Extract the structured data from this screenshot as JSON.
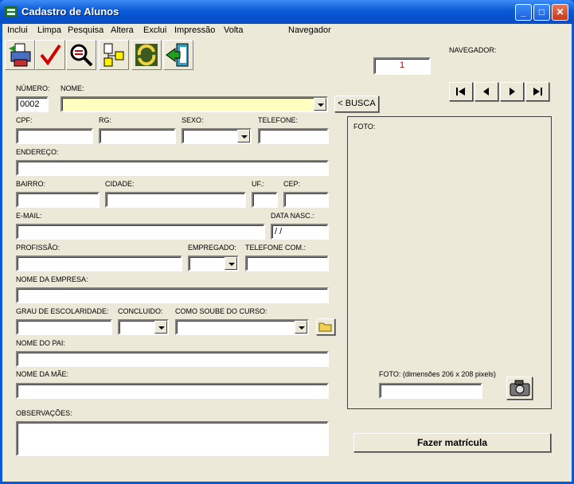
{
  "window": {
    "title": "Cadastro de Alunos",
    "minimize_glyph": "_",
    "maximize_glyph": "□",
    "close_glyph": "✕"
  },
  "menu": [
    "Inclui",
    "Limpa",
    "Pesquisa",
    "Altera",
    "Exclui",
    "Impressão",
    "Volta",
    "Navegador"
  ],
  "toolbar": [
    {
      "name": "include-icon"
    },
    {
      "name": "check-icon"
    },
    {
      "name": "search-icon"
    },
    {
      "name": "tree-icon"
    },
    {
      "name": "refresh-icon"
    },
    {
      "name": "exit-icon"
    }
  ],
  "navigator": {
    "label": "NAVEGADOR:",
    "record": "1"
  },
  "form": {
    "numero_label": "NÚMERO:",
    "numero_value": "0002",
    "nome_label": "NOME:",
    "busca_label": "< BUSCA",
    "cpf_label": "CPF:",
    "rg_label": "RG:",
    "sexo_label": "SEXO:",
    "telefone_label": "TELEFONE:",
    "endereco_label": "ENDEREÇO:",
    "bairro_label": "BAIRRO:",
    "cidade_label": "CIDADE:",
    "uf_label": "UF.:",
    "cep_label": "CEP:",
    "email_label": "E-MAIL:",
    "data_nasc_label": "DATA NASC.:",
    "data_nasc_value": " / /",
    "profissao_label": "PROFISSÃO:",
    "empregado_label": "EMPREGADO:",
    "telefone_com_label": "TELEFONE COM.:",
    "nome_empresa_label": "NOME DA EMPRESA:",
    "grau_label": "GRAU DE ESCOLARIDADE:",
    "concluido_label": "CONCLUIDO:",
    "como_soube_label": "COMO SOUBE DO CURSO:",
    "nome_pai_label": "NOME DO PAI:",
    "nome_mae_label": "NOME DA MÃE:",
    "observacoes_label": "OBSERVAÇÕES:"
  },
  "photo": {
    "label": "FOTO:",
    "dims_label": "FOTO: (dimensões 206 x 208 pixels)"
  },
  "matricula_button": "Fazer matrícula",
  "colors": {
    "title_bar": "#0a5ad6",
    "client_bg": "#ece9d8",
    "name_field_bg": "#ffffc0",
    "record_text": "#c00000"
  }
}
